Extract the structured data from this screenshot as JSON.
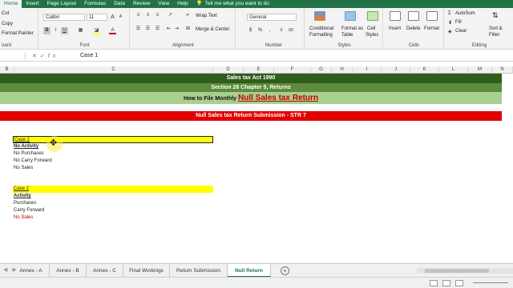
{
  "ribbon_tabs": [
    "Home",
    "Insert",
    "Page Layout",
    "Formulas",
    "Data",
    "Review",
    "View",
    "Help"
  ],
  "tell_me": "Tell me what you want to do",
  "clipboard": {
    "cut": "Cut",
    "copy": "Copy",
    "format_painter": "Format Painter",
    "label": "oard"
  },
  "font": {
    "name": "Calibri",
    "size": "11",
    "label": "Font",
    "bold": "B",
    "italic": "I",
    "underline": "U"
  },
  "alignment": {
    "wrap_text": "Wrap Text",
    "merge_center": "Merge & Center",
    "label": "Alignment"
  },
  "number": {
    "format": "General",
    "label": "Number",
    "currency": "$",
    "percent": "%",
    "comma": ","
  },
  "styles": {
    "conditional": [
      "Conditional",
      "Formatting"
    ],
    "format_table": [
      "Format as",
      "Table"
    ],
    "cell_styles": [
      "Cell",
      "Styles"
    ],
    "label": "Styles"
  },
  "cells": {
    "insert": "Insert",
    "delete": "Delete",
    "format": "Format",
    "label": "Cells"
  },
  "editing": {
    "autosum": "AutoSum",
    "fill": "Fill",
    "clear": "Clear",
    "sort": [
      "Sort &",
      "Filter"
    ],
    "label": "Editing"
  },
  "formula_bar": {
    "value": "Case 1",
    "cancel": "✕",
    "enter": "✓",
    "fx": "fx"
  },
  "columns": [
    "B",
    "C",
    "D",
    "E",
    "F",
    "G",
    "H",
    "I",
    "J",
    "K",
    "L",
    "M",
    "N"
  ],
  "sheet": {
    "band1": "Sales tax Act 1990",
    "band2": "Section 26 Chapter 5, Returns",
    "band3_prefix": "How to File Monthly ",
    "band3_big": "Null Sales tax Return",
    "band4": "Null Sales tax Return Submission - STR 7",
    "case1": {
      "title": "Case 1",
      "heading": "No Activity",
      "lines": [
        "No Purchases",
        "No Carry Forward",
        "No Sales"
      ]
    },
    "case2": {
      "title": "Case 2",
      "heading": "Activity",
      "lines": [
        "Purchases",
        "Carry Forward",
        "No Sales"
      ]
    }
  },
  "sheet_tabs": [
    "Annex - A",
    "Annex - B",
    "Annex - C",
    "Final Workings",
    "Return Submission",
    "Null Return"
  ],
  "active_sheet": "Null Return",
  "add_sheet": "+",
  "colors": {
    "excel_green": "#217346",
    "band_dark": "#2e5e1a",
    "band_mid": "#5d8b3c",
    "band_light": "#a9d08e",
    "band_red": "#e00000",
    "case_yellow": "#ffff00",
    "text_red": "#c00000"
  }
}
